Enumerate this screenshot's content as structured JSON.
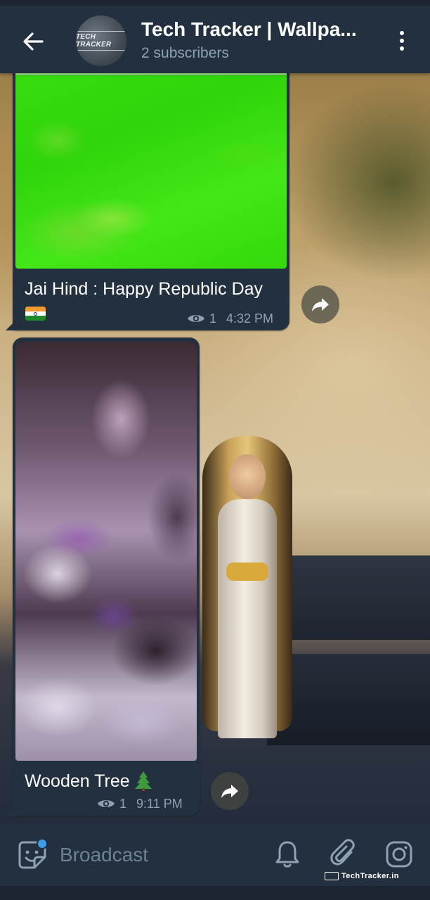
{
  "header": {
    "title": "Tech Tracker | Wallpa...",
    "subtitle": "2 subscribers",
    "avatar_text": "TECH TRACKER",
    "back_icon": "arrow-left-icon",
    "menu_icon": "more-vertical-icon"
  },
  "messages": [
    {
      "caption": "Jai Hind : Happy Republic Day",
      "emoji": "🇮🇳",
      "views": "1",
      "time": "4:32 PM"
    },
    {
      "caption": "Wooden Tree",
      "emoji": "🌲",
      "views": "1",
      "time": "9:11 PM"
    }
  ],
  "composer": {
    "placeholder": "Broadcast",
    "icons": [
      "sticker-icon",
      "bell-icon",
      "paperclip-icon",
      "instagram-icon"
    ]
  },
  "watermark": "TechTracker.in",
  "colors": {
    "header_bg": "#22303f",
    "bubble_bg": "#22303f",
    "subtitle": "#8fa2b3",
    "accent": "#3d9be9"
  }
}
